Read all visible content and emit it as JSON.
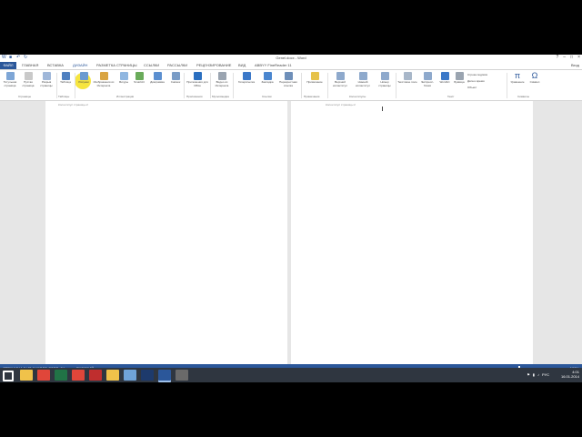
{
  "title_bar": {
    "document_title": "Genel.docx - Word"
  },
  "tabs": [
    "ФАЙЛ",
    "ГЛАВНАЯ",
    "ВСТАВКА",
    "ДИЗАЙН",
    "РАЗМЕТКА СТРАНИЦЫ",
    "ССЫЛКИ",
    "РАССЫЛКИ",
    "РЕЦЕНЗИРОВАНИЕ",
    "ВИД",
    "ABBYY FineReader 11"
  ],
  "user_name": "Вход",
  "ribbon": {
    "buttons": [
      {
        "label": "Титульная страница",
        "icon": "cover-page-icon",
        "color": "#7ea6d6"
      },
      {
        "label": "Пустая страница",
        "icon": "blank-page-icon",
        "color": "#c9c9c9"
      },
      {
        "label": "Разрыв страницы",
        "icon": "page-break-icon",
        "color": "#9fb7d9"
      },
      {
        "label": "Таблица",
        "icon": "table-icon",
        "color": "#4e7fbf"
      },
      {
        "label": "Рисунки",
        "icon": "pictures-icon",
        "color": "#6a9ad0"
      },
      {
        "label": "Изображения из Интернета",
        "icon": "online-pictures-icon",
        "color": "#d9a441"
      },
      {
        "label": "Фигуры",
        "icon": "shapes-icon",
        "color": "#8fb6e0"
      },
      {
        "label": "SmartArt",
        "icon": "smartart-icon",
        "color": "#6aab5a"
      },
      {
        "label": "Диаграмма",
        "icon": "chart-icon",
        "color": "#5b8fd0"
      },
      {
        "label": "Снимок",
        "icon": "screenshot-icon",
        "color": "#7a9cc6"
      },
      {
        "label": "Приложения для Office",
        "icon": "apps-for-office-icon",
        "color": "#2b6fc0"
      },
      {
        "label": "Видео из Интернета",
        "icon": "online-video-icon",
        "color": "#9aa4b0"
      },
      {
        "label": "Гиперссылка",
        "icon": "hyperlink-icon",
        "color": "#3b78c8"
      },
      {
        "label": "Закладка",
        "icon": "bookmark-icon",
        "color": "#4a86cf"
      },
      {
        "label": "Перекрестная ссылка",
        "icon": "cross-reference-icon",
        "color": "#6e8fb9"
      },
      {
        "label": "Примечание",
        "icon": "comment-icon",
        "color": "#e6c24a"
      },
      {
        "label": "Верхний колонтитул",
        "icon": "header-icon",
        "color": "#8ea9cc"
      },
      {
        "label": "Нижний колонтитул",
        "icon": "footer-icon",
        "color": "#8ea9cc"
      },
      {
        "label": "Номер страницы",
        "icon": "page-number-icon",
        "color": "#8ea9cc"
      },
      {
        "label": "Текстовое поле",
        "icon": "text-box-icon",
        "color": "#a8b7c9"
      },
      {
        "label": "Экспресс-блоки",
        "icon": "quick-parts-icon",
        "color": "#8ea9cc"
      },
      {
        "label": "WordArt",
        "icon": "wordart-icon",
        "color": "#3b78c8"
      },
      {
        "label": "Буквица",
        "icon": "drop-cap-icon",
        "color": "#9aa4b0"
      },
      {
        "label": "Уравнение",
        "icon": "equation-icon",
        "color": "#2b579a"
      },
      {
        "label": "Символ",
        "icon": "symbol-icon",
        "color": "#2b579a"
      }
    ],
    "groups": [
      "Страницы",
      "Таблицы",
      "Иллюстрации",
      "Приложения",
      "Мультимедиа",
      "Ссылки",
      "Примечания",
      "Колонтитулы",
      "Текст",
      "Символы"
    ],
    "text_options": [
      "Строка подписи",
      "Дата и время",
      "Объект"
    ]
  },
  "pages": {
    "header_hint": "Колонтитул страницы 2"
  },
  "status_bar": {
    "page": "СТРАНИЦА 2 ИЗ 6",
    "words": "ЧИСЛО СЛОВ: 24",
    "language": "РУССКИЙ",
    "zoom": "100%"
  },
  "taskbar": {
    "apps": [
      {
        "name": "start-icon",
        "color": "#ffffff"
      },
      {
        "name": "explorer-icon",
        "color": "#f0c24a"
      },
      {
        "name": "chrome-icon",
        "color": "#e0463a"
      },
      {
        "name": "excel-icon",
        "color": "#217346"
      },
      {
        "name": "chrome-icon",
        "color": "#e0463a"
      },
      {
        "name": "filezilla-icon",
        "color": "#bf2e2e"
      },
      {
        "name": "explorer-icon",
        "color": "#f0c24a"
      },
      {
        "name": "monitor-icon",
        "color": "#6fa3d8"
      },
      {
        "name": "photoshop-icon",
        "color": "#1d3a6c"
      },
      {
        "name": "word-icon",
        "color": "#2b579a"
      },
      {
        "name": "media-icon",
        "color": "#6a6a6a"
      }
    ],
    "clock_time": "4:01",
    "clock_date": "16.01.2014",
    "lang": "РУС"
  }
}
